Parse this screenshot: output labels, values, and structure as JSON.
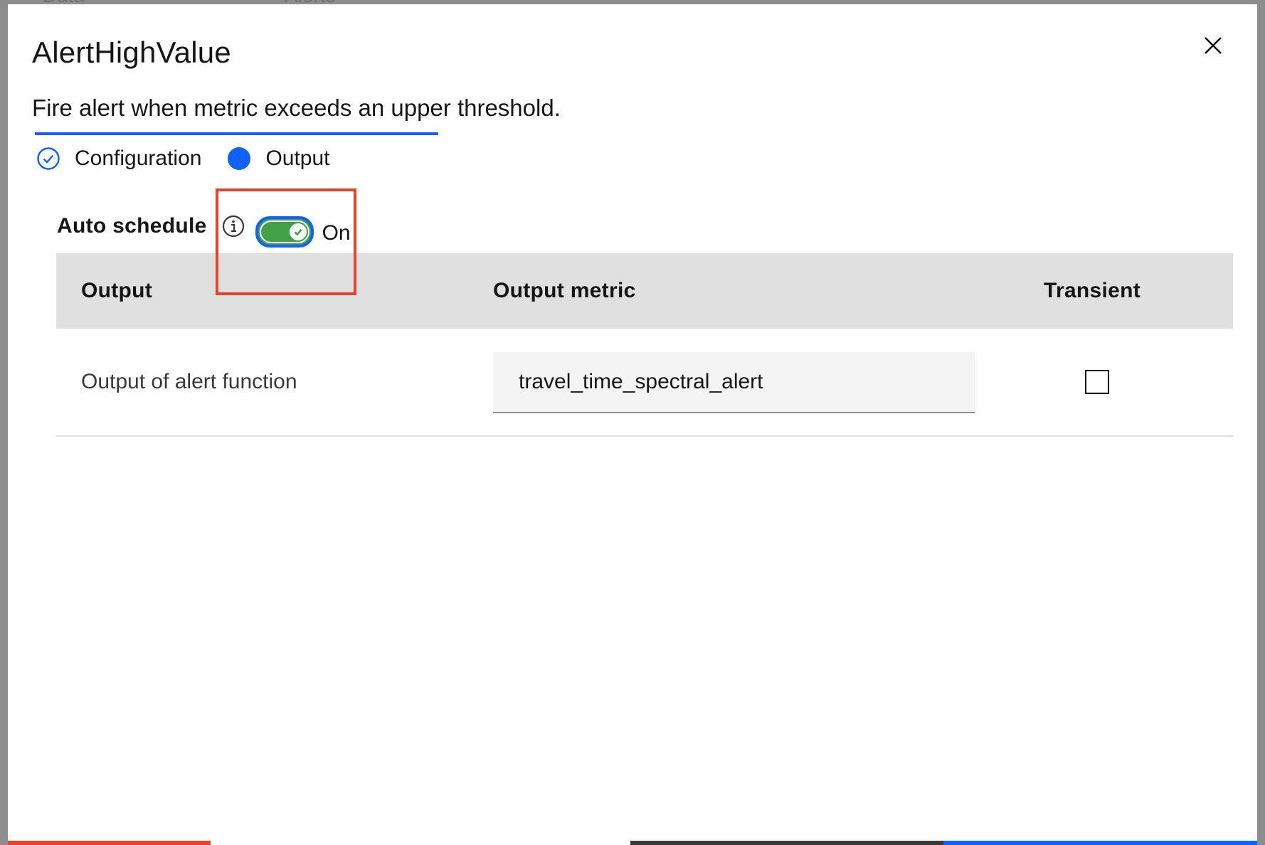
{
  "background": {
    "text_items": [
      "Data",
      "Alerts"
    ]
  },
  "modal": {
    "title": "AlertHighValue",
    "description": "Fire alert when metric exceeds an upper threshold.",
    "close_icon": "close-icon",
    "steps": [
      {
        "label": "Configuration",
        "state": "complete",
        "icon": "checkmark-outline-icon"
      },
      {
        "label": "Output",
        "state": "current",
        "icon": "filled-circle-icon"
      }
    ],
    "auto_schedule": {
      "label": "Auto schedule",
      "info_icon": "information-icon",
      "toggle_checked": true,
      "state_text": "On"
    },
    "table": {
      "headers": [
        "Output",
        "Output metric",
        "Transient"
      ],
      "rows": [
        {
          "output": "Output of alert function",
          "output_metric": "travel_time_spectral_alert",
          "transient": false
        }
      ]
    }
  },
  "colors": {
    "accent": "#0f62fe",
    "toggle_on": "#42a047",
    "highlight": "#e8432b",
    "header_bg": "#e0e0e0",
    "input_bg": "#f4f4f4"
  }
}
